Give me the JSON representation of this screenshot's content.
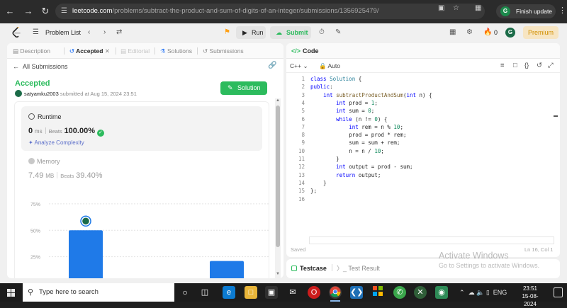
{
  "browser": {
    "url_domain": "leetcode.com",
    "url_path": "/problems/subtract-the-product-and-sum-of-digits-of-an-integer/submissions/1356925479/",
    "finish_update_label": "Finish update"
  },
  "header": {
    "problem_list_label": "Problem List",
    "run_label": "Run",
    "submit_label": "Submit",
    "streak_count": "0",
    "premium_label": "Premium"
  },
  "left_tabs": {
    "description": "Description",
    "accepted": "Accepted",
    "editorial": "Editorial",
    "solutions": "Solutions",
    "submissions": "Submissions"
  },
  "submission": {
    "all_submissions_label": "All Submissions",
    "status": "Accepted",
    "username": "satyamku2003",
    "submitted_text": "submitted at Aug 15, 2024 23:51",
    "solution_button": "Solution",
    "runtime_label": "Runtime",
    "runtime_value": "0",
    "runtime_unit": "ms",
    "runtime_beats_label": "Beats",
    "runtime_beats": "100.00%",
    "analyze_label": "Analyze Complexity",
    "memory_label": "Memory",
    "memory_value": "7.49",
    "memory_unit": "MB",
    "memory_beats_label": "Beats",
    "memory_beats": "39.40%"
  },
  "chart_data": {
    "type": "bar",
    "y_tick_labels": [
      "75%",
      "50%",
      "25%"
    ],
    "yticks": [
      75,
      50,
      25
    ],
    "ylim": [
      0,
      87
    ],
    "values": [
      50,
      21
    ],
    "colors": {
      "bar": "#1f7ae8",
      "grid": "#e3e3e3",
      "tick": "#a0a0a0"
    }
  },
  "code_panel": {
    "tab_label": "Code",
    "language": "C++",
    "mode": "Auto",
    "lines": [
      "class Solution {",
      "public:",
      "    int subtractProductAndSum(int n) {",
      "        int prod = 1;",
      "        int sum = 0;",
      "        while (n != 0) {",
      "            int rem = n % 10;",
      "            prod = prod * rem;",
      "            sum = sum + rem;",
      "            n = n / 10;",
      "        }",
      "        int output = prod - sum;",
      "        return output;",
      "    }",
      "};",
      ""
    ],
    "line_numbers": [
      "1",
      "2",
      "3",
      "4",
      "5",
      "6",
      "7",
      "8",
      "9",
      "10",
      "11",
      "12",
      "13",
      "14",
      "15",
      "16"
    ],
    "saved_label": "Saved",
    "cursor_label": "Ln 16, Col 1"
  },
  "bottom_panel": {
    "testcase_label": "Testcase",
    "test_result_label": "Test Result"
  },
  "watermark": {
    "title": "Activate Windows",
    "subtitle": "Go to Settings to activate Windows."
  },
  "taskbar": {
    "search_placeholder": "Type here to search",
    "language": "ENG",
    "time": "23:51",
    "date": "15-08-2024"
  }
}
